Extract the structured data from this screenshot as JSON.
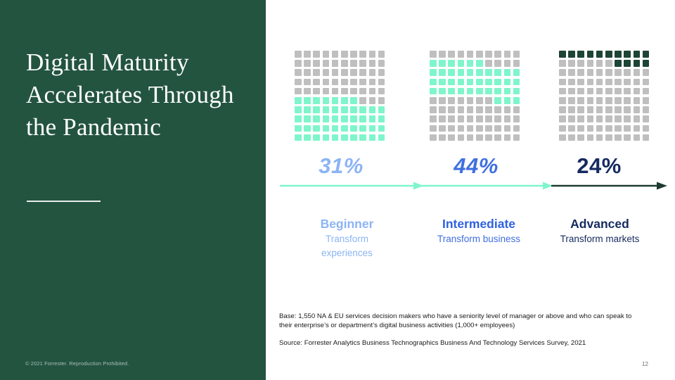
{
  "slide": {
    "title": "Digital Maturity Accelerates Through the Pandemic",
    "copyright": "© 2021 Forrester. Reproduction Prohibited.",
    "page_number": "12"
  },
  "colors": {
    "panel_green": "#235440",
    "dot_gray": "#bfbfbf",
    "dot_teal": "#7ff5cc",
    "dot_dark_green": "#1d4435",
    "pct_beginner": "#8cb4f5",
    "pct_intermediate": "#3f6fe0",
    "pct_advanced": "#152a5e",
    "arrow_teal": "#7ff5cc",
    "arrow_dark": "#1f3b33"
  },
  "stages": [
    {
      "key": "beginner",
      "percent": "31%",
      "name": "Beginner",
      "subtitle": "Transform experiences",
      "percent_color": "#8cb4f5",
      "name_color": "#8cb4f5",
      "subtitle_color": "#8cb4f5",
      "fill_color": "#7ff5cc"
    },
    {
      "key": "intermediate",
      "percent": "44%",
      "name": "Intermediate",
      "subtitle": "Transform business",
      "percent_color": "#3f6fe0",
      "name_color": "#2f62de",
      "subtitle_color": "#3f6fe0",
      "fill_color": "#7ff5cc"
    },
    {
      "key": "advanced",
      "percent": "24%",
      "name": "Advanced",
      "subtitle": "Transform markets",
      "percent_color": "#152a5e",
      "name_color": "#152a5e",
      "subtitle_color": "#152a5e",
      "fill_color": "#1d4435"
    }
  ],
  "footnotes": {
    "base": "Base: 1,550 NA & EU services decision makers who have a seniority level of manager or above and who can speak to their enterprise’s or department’s digital business activities (1,000+ employees)",
    "source": "Source: Forrester Analytics Business Technographics Business And Technology Services Survey, 2021"
  },
  "chart_data": {
    "type": "bar",
    "title": "Digital Maturity Accelerates Through the Pandemic",
    "subtype": "waffle-grid",
    "categories": [
      "Beginner",
      "Intermediate",
      "Advanced"
    ],
    "values": [
      31,
      44,
      24
    ],
    "value_labels": [
      "31%",
      "44%",
      "24%"
    ],
    "unit": "percent of respondents",
    "grid": {
      "rows": 10,
      "cols": 10,
      "total_cells": 100
    },
    "legend": [
      "Transform experiences",
      "Transform business",
      "Transform markets"
    ],
    "xlabel": "",
    "ylabel": "",
    "ylim": [
      0,
      100
    ],
    "gridlines": false,
    "waffle_rows": [
      {
        "category": "Beginner",
        "fill_color": "#7ff5cc",
        "rows": [
          [
            0,
            0,
            0,
            0,
            0,
            0,
            0,
            0,
            0,
            0
          ],
          [
            0,
            0,
            0,
            0,
            0,
            0,
            0,
            0,
            0,
            0
          ],
          [
            0,
            0,
            0,
            0,
            0,
            0,
            0,
            0,
            0,
            0
          ],
          [
            0,
            0,
            0,
            0,
            0,
            0,
            0,
            0,
            0,
            0
          ],
          [
            0,
            0,
            0,
            0,
            0,
            0,
            0,
            0,
            0,
            0
          ],
          [
            1,
            1,
            1,
            1,
            1,
            1,
            1,
            0,
            0,
            0
          ],
          [
            1,
            1,
            1,
            1,
            1,
            1,
            1,
            1,
            1,
            1
          ],
          [
            1,
            1,
            1,
            1,
            1,
            1,
            1,
            1,
            1,
            1
          ],
          [
            1,
            1,
            1,
            1,
            1,
            1,
            1,
            1,
            1,
            1
          ],
          [
            1,
            1,
            1,
            1,
            1,
            1,
            1,
            1,
            1,
            1
          ]
        ]
      },
      {
        "category": "Intermediate",
        "fill_color": "#7ff5cc",
        "rows": [
          [
            0,
            0,
            0,
            0,
            0,
            0,
            0,
            0,
            0,
            0
          ],
          [
            1,
            1,
            1,
            1,
            1,
            1,
            0,
            0,
            0,
            0
          ],
          [
            1,
            1,
            1,
            1,
            1,
            1,
            1,
            1,
            1,
            1
          ],
          [
            1,
            1,
            1,
            1,
            1,
            1,
            1,
            1,
            1,
            1
          ],
          [
            1,
            1,
            1,
            1,
            1,
            1,
            1,
            1,
            1,
            1
          ],
          [
            0,
            0,
            0,
            0,
            0,
            0,
            0,
            1,
            1,
            1
          ],
          [
            0,
            0,
            0,
            0,
            0,
            0,
            0,
            0,
            0,
            0
          ],
          [
            0,
            0,
            0,
            0,
            0,
            0,
            0,
            0,
            0,
            0
          ],
          [
            0,
            0,
            0,
            0,
            0,
            0,
            0,
            0,
            0,
            0
          ],
          [
            0,
            0,
            0,
            0,
            0,
            0,
            0,
            0,
            0,
            0
          ]
        ]
      },
      {
        "category": "Advanced",
        "fill_color": "#1d4435",
        "rows": [
          [
            1,
            1,
            1,
            1,
            1,
            1,
            1,
            1,
            1,
            1
          ],
          [
            0,
            0,
            0,
            0,
            0,
            0,
            1,
            1,
            1,
            1
          ],
          [
            0,
            0,
            0,
            0,
            0,
            0,
            0,
            0,
            0,
            0
          ],
          [
            0,
            0,
            0,
            0,
            0,
            0,
            0,
            0,
            0,
            0
          ],
          [
            0,
            0,
            0,
            0,
            0,
            0,
            0,
            0,
            0,
            0
          ],
          [
            0,
            0,
            0,
            0,
            0,
            0,
            0,
            0,
            0,
            0
          ],
          [
            0,
            0,
            0,
            0,
            0,
            0,
            0,
            0,
            0,
            0
          ],
          [
            0,
            0,
            0,
            0,
            0,
            0,
            0,
            0,
            0,
            0
          ],
          [
            0,
            0,
            0,
            0,
            0,
            0,
            0,
            0,
            0,
            0
          ],
          [
            0,
            0,
            0,
            0,
            0,
            0,
            0,
            0,
            0,
            0
          ]
        ]
      }
    ]
  }
}
